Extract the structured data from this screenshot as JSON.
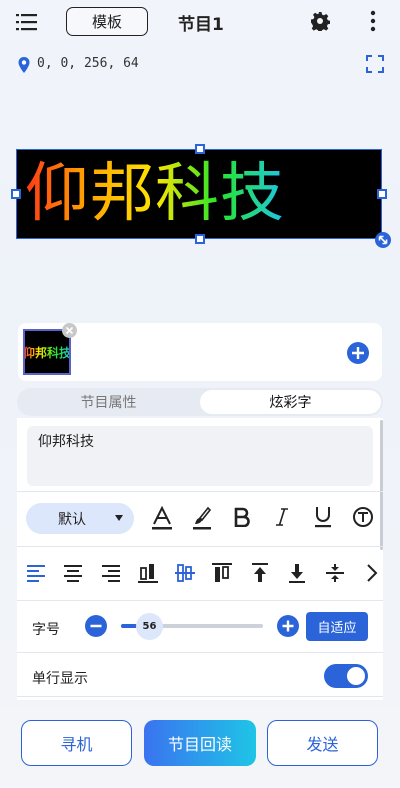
{
  "header": {
    "template_label": "模板",
    "title": "节目1"
  },
  "area": {
    "coords": "0, 0, 256, 64"
  },
  "preview": {
    "text": "仰邦科技"
  },
  "programs": {
    "thumbnail_text": "仰邦科技"
  },
  "tabs": [
    {
      "label": "节目属性",
      "active": false
    },
    {
      "label": "炫彩字",
      "active": true
    }
  ],
  "editor": {
    "text_value": "仰邦科技",
    "font_select": "默认",
    "font_size_label": "字号",
    "font_size_value": "56",
    "auto_fit_label": "自适应",
    "single_line_label": "单行显示",
    "single_line_on": true
  },
  "format_icons": [
    "text-color-icon",
    "brush-icon",
    "bold-icon",
    "italic-icon",
    "underline-icon",
    "font-effect-icon"
  ],
  "align_icons": [
    "align-left-icon",
    "align-center-icon",
    "align-right-icon",
    "align-bottom-icon",
    "align-vcenter-icon",
    "align-top-icon",
    "arrow-up-icon",
    "arrow-down-icon",
    "compress-icon",
    "chevron-right-icon"
  ],
  "colors": {
    "accent": "#2b63d9"
  },
  "bottom": {
    "search_label": "寻机",
    "readback_label": "节目回读",
    "send_label": "发送"
  }
}
